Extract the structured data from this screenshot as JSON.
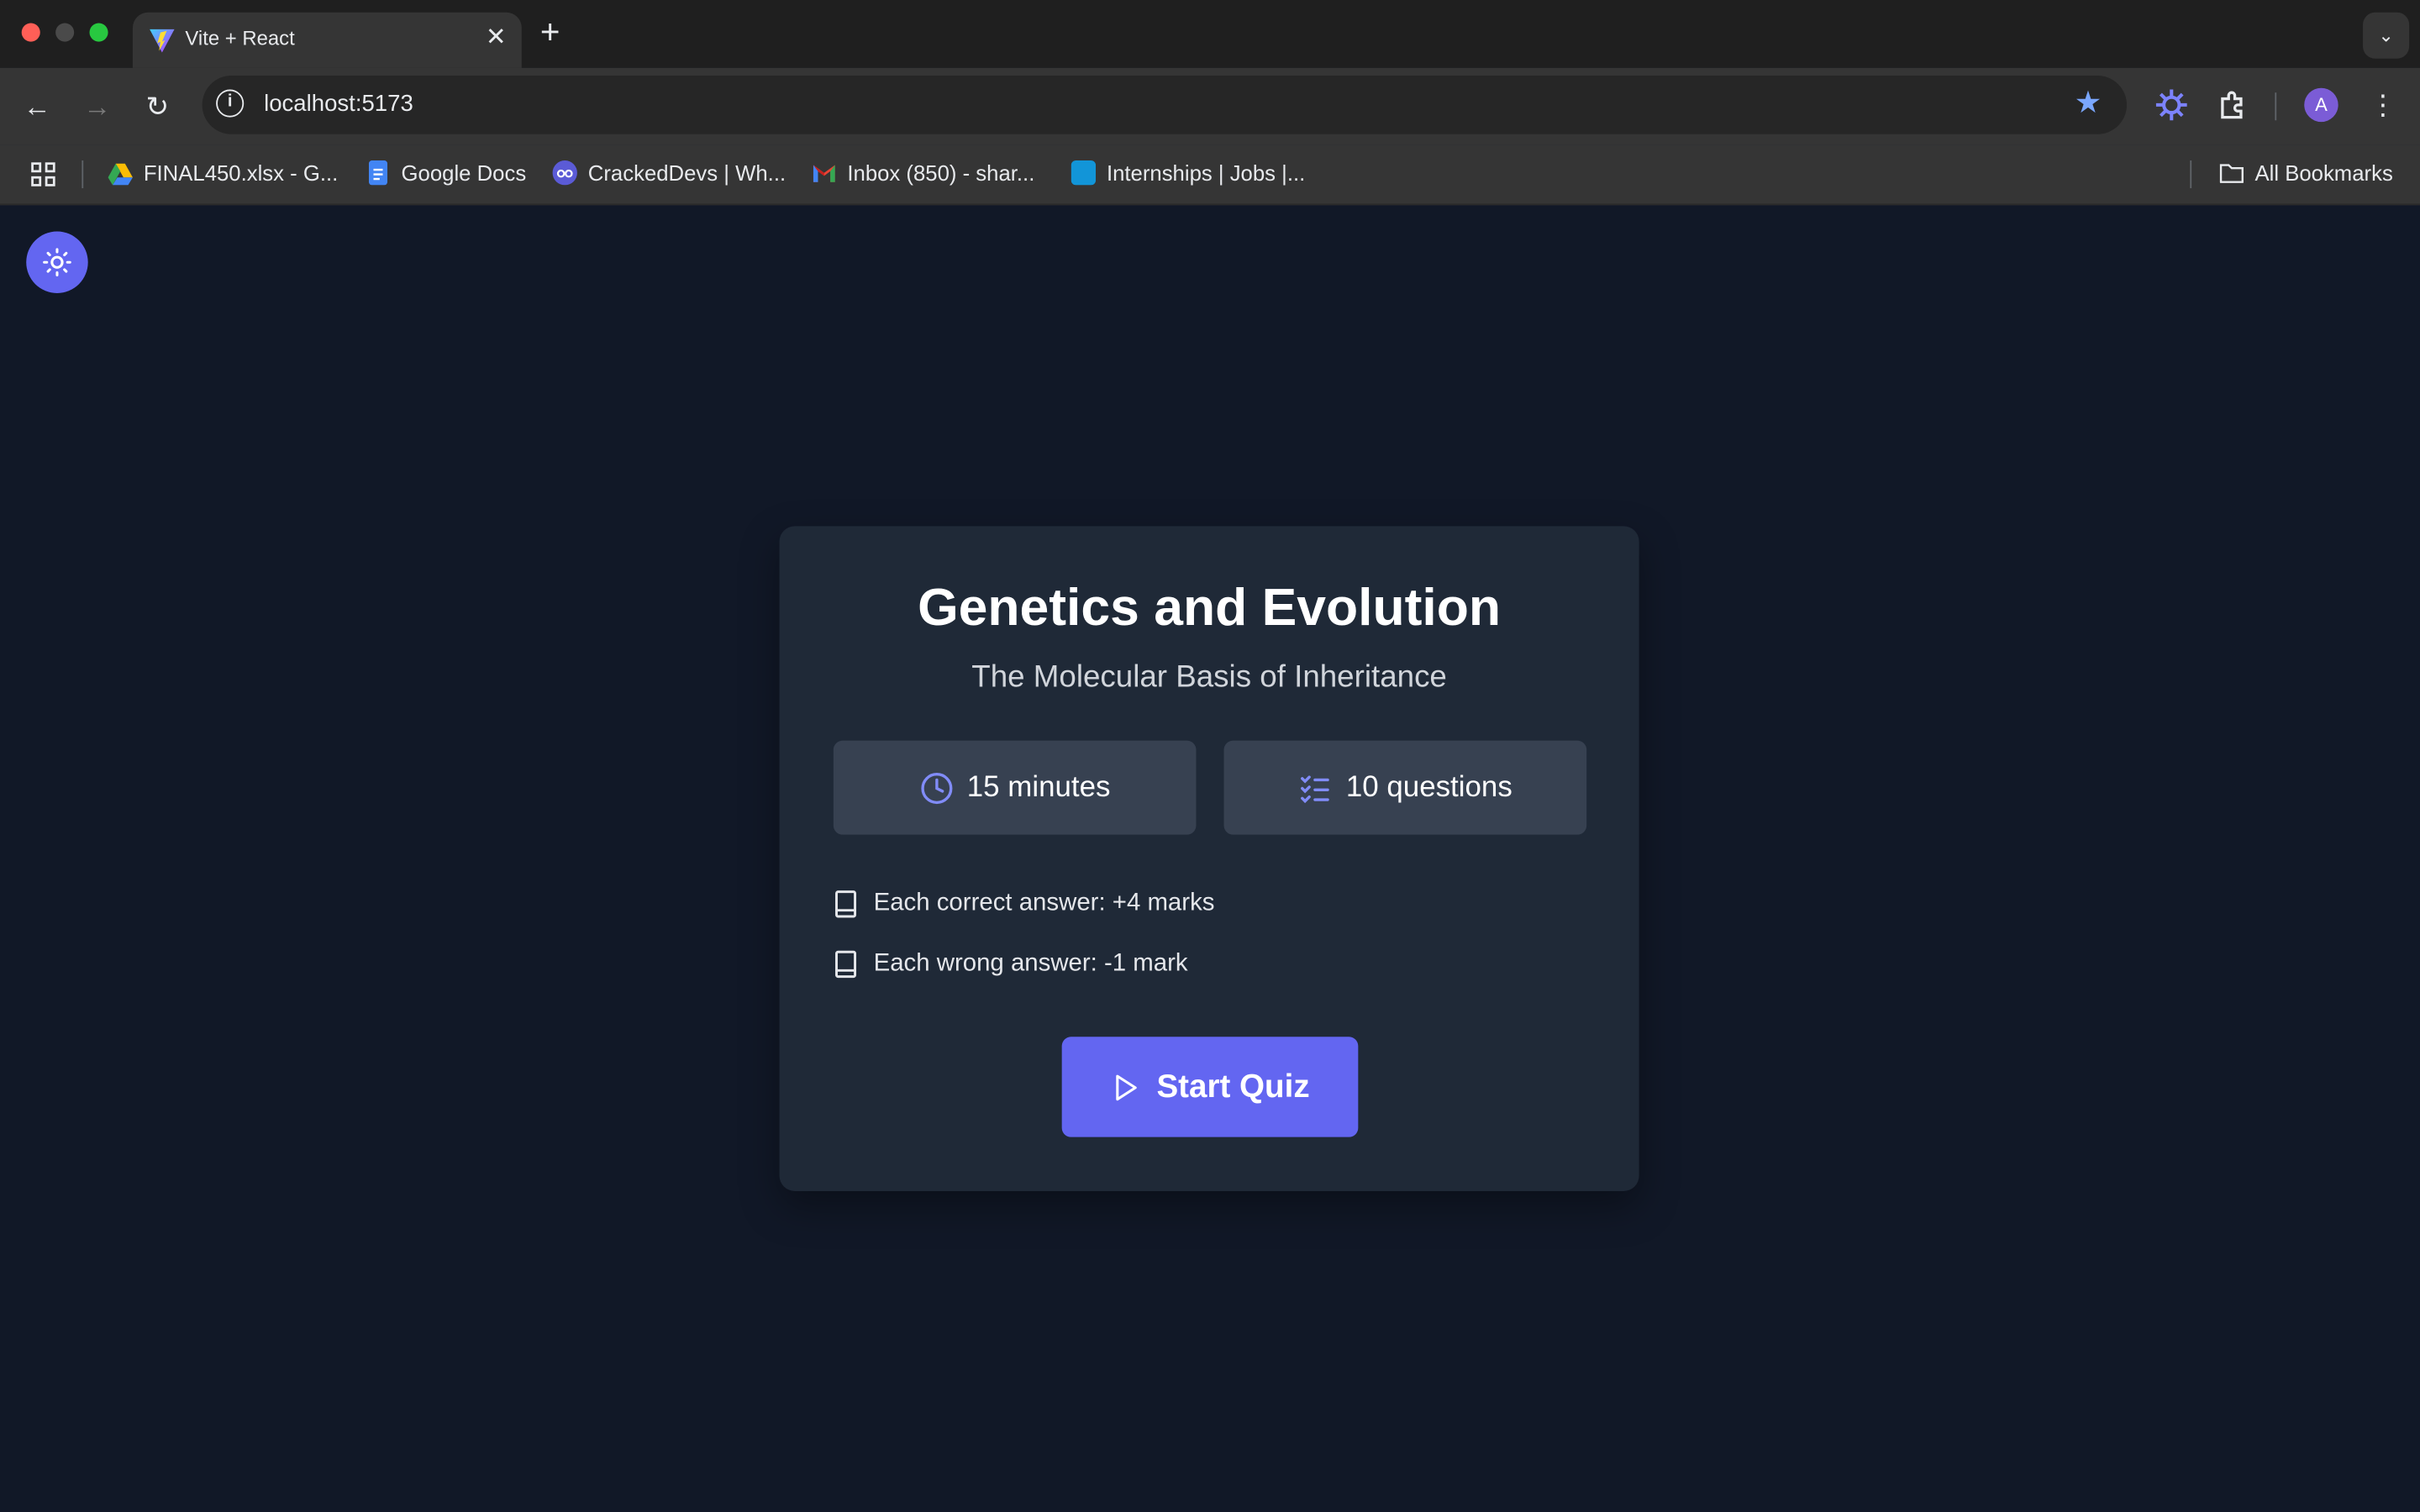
{
  "browser": {
    "tab_title": "Vite + React",
    "url": "localhost:5173",
    "profile_initial": "A",
    "bookmarks": [
      {
        "label": "FINAL450.xlsx - G..."
      },
      {
        "label": "Google Docs"
      },
      {
        "label": "CrackedDevs | Wh..."
      },
      {
        "label": "Inbox (850) - shar..."
      },
      {
        "label": "Internships | Jobs |..."
      }
    ],
    "all_bookmarks_label": "All Bookmarks"
  },
  "quiz": {
    "title": "Genetics and Evolution",
    "subtitle": "The Molecular Basis of Inheritance",
    "duration": "15 minutes",
    "questions": "10 questions",
    "rules": [
      "Each correct answer: +4 marks",
      "Each wrong answer: -1 mark"
    ],
    "start_label": "Start Quiz"
  },
  "colors": {
    "accent": "#6366f1",
    "page_bg": "#111827",
    "card_bg": "#1f2937",
    "stat_bg": "#374151"
  }
}
